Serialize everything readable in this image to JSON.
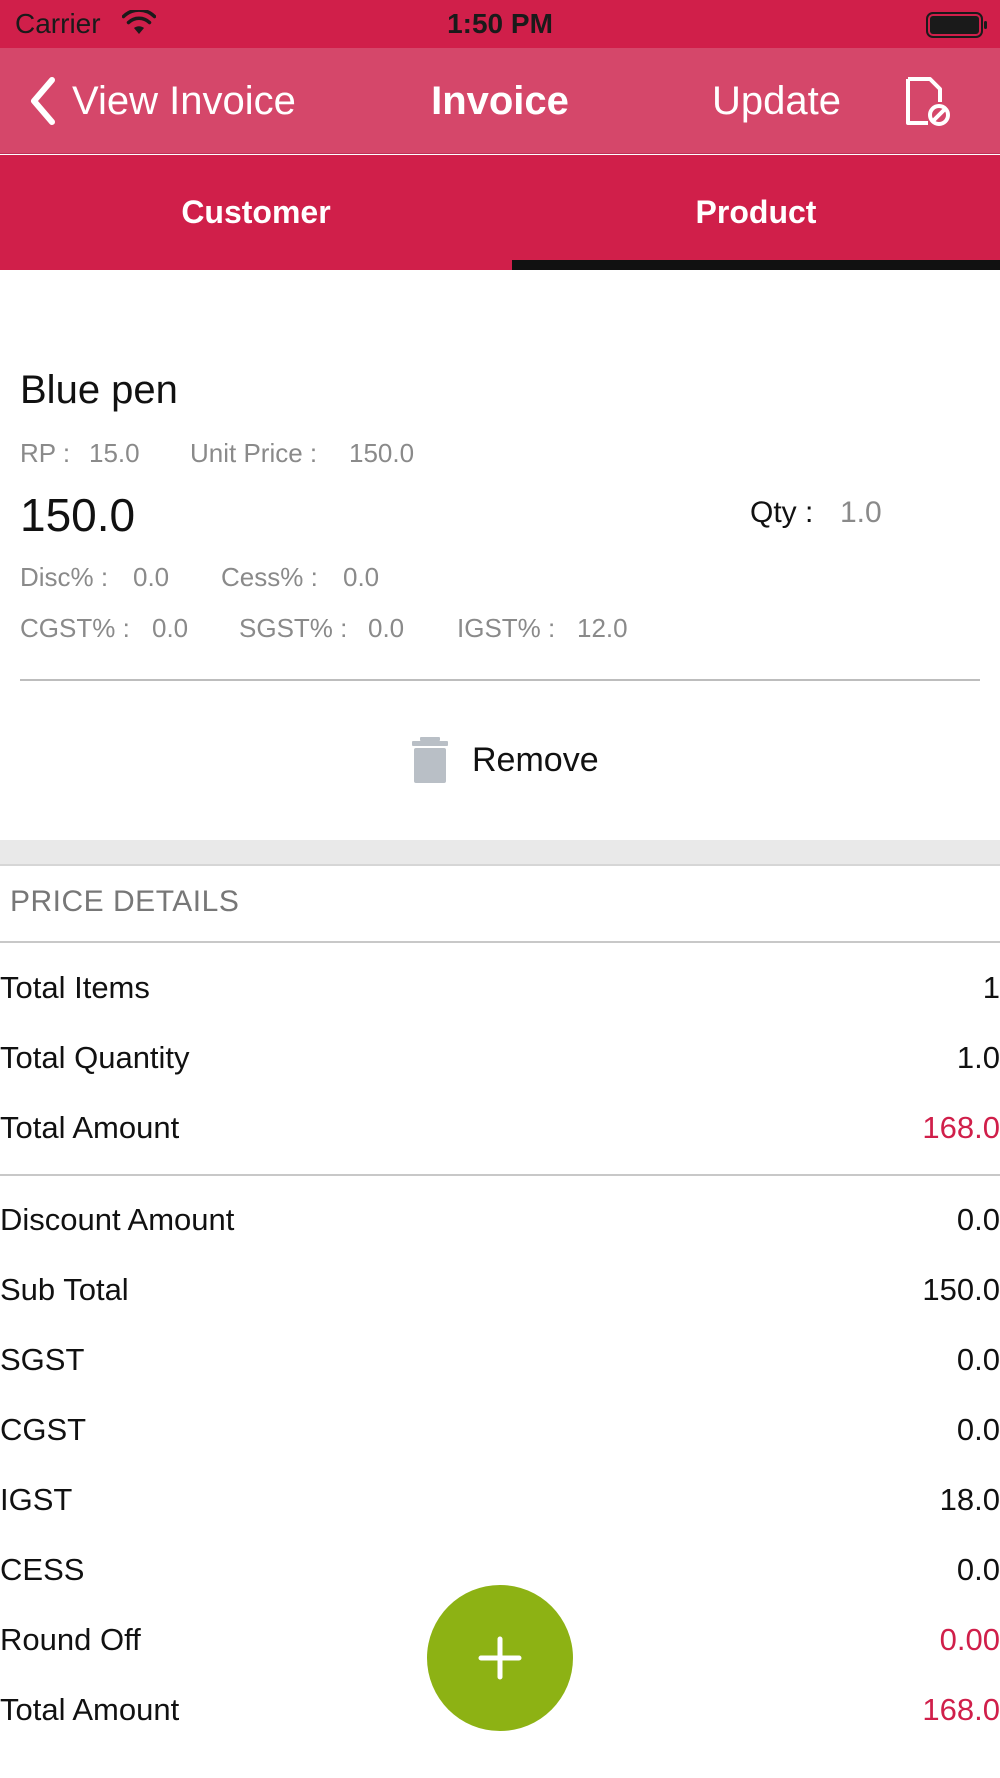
{
  "status_bar": {
    "carrier": "Carrier",
    "time": "1:50 PM"
  },
  "nav": {
    "back_label": "View Invoice",
    "title": "Invoice",
    "update_label": "Update"
  },
  "tabs": [
    {
      "label": "Customer",
      "selected": false
    },
    {
      "label": "Product",
      "selected": true
    }
  ],
  "product": {
    "name": "Blue pen",
    "rp_label": "RP :",
    "rp_value": "15.0",
    "unit_price_label": "Unit Price :",
    "unit_price_value": "150.0",
    "price": "150.0",
    "qty_label": "Qty :",
    "qty_value": "1.0",
    "disc_label": "Disc% :",
    "disc_value": "0.0",
    "cess_label": "Cess% :",
    "cess_value": "0.0",
    "cgst_label": "CGST% :",
    "cgst_value": "0.0",
    "sgst_label": "SGST% :",
    "sgst_value": "0.0",
    "igst_label": "IGST% :",
    "igst_value": "12.0",
    "remove_label": "Remove"
  },
  "price_details": {
    "header": "PRICE DETAILS",
    "summary_rows": [
      {
        "label": "Total Items",
        "value": "1"
      },
      {
        "label": "Total Quantity",
        "value": "1.0"
      },
      {
        "label": "Total Amount",
        "value": "168.0"
      }
    ],
    "breakdown_rows": [
      {
        "label": "Discount Amount",
        "value": "0.0"
      },
      {
        "label": "Sub Total",
        "value": "150.0"
      },
      {
        "label": "SGST",
        "value": "0.0"
      },
      {
        "label": "CGST",
        "value": "0.0"
      },
      {
        "label": "IGST",
        "value": "18.0"
      },
      {
        "label": "CESS",
        "value": "0.0"
      },
      {
        "label": "Round Off",
        "value": "0.00"
      },
      {
        "label": "Total Amount",
        "value": "168.0"
      }
    ]
  },
  "colors": {
    "brand": "#d01f4a",
    "nav_bar": "#d5476a",
    "fab": "#8db214",
    "accent_value": "#d01f4a"
  },
  "icons": {
    "back": "chevron-left-icon",
    "doc": "document-cancel-icon",
    "remove": "trash-icon",
    "fab": "plus-icon"
  }
}
